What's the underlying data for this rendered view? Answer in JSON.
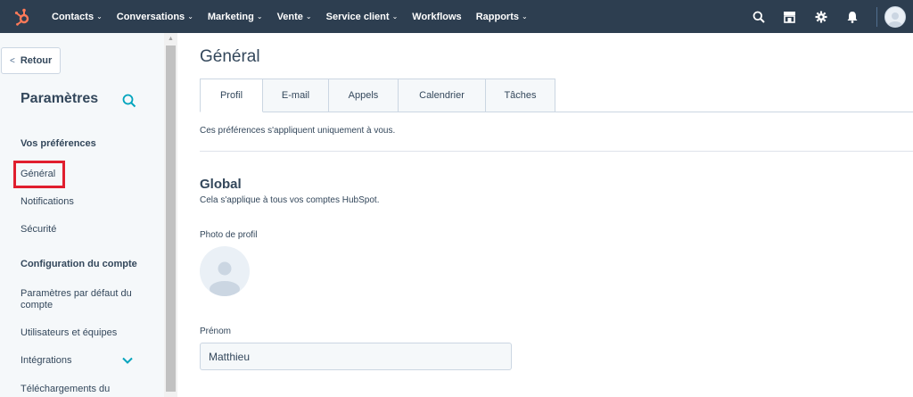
{
  "colors": {
    "nav_bg": "#2d3e50",
    "brand_orange": "#ff7a59",
    "accent_teal": "#00a4bd",
    "highlight_red": "#e01e2e",
    "text": "#33475b"
  },
  "topnav": {
    "logo_icon": "hubspot-sprocket-icon",
    "items": [
      {
        "label": "Contacts",
        "chevron": "⌄"
      },
      {
        "label": "Conversations",
        "chevron": "⌄"
      },
      {
        "label": "Marketing",
        "chevron": "⌄"
      },
      {
        "label": "Vente",
        "chevron": "⌄"
      },
      {
        "label": "Service client",
        "chevron": "⌄"
      },
      {
        "label": "Workflows",
        "chevron": ""
      },
      {
        "label": "Rapports",
        "chevron": "⌄"
      }
    ],
    "right_icons": [
      "search-icon",
      "marketplace-icon",
      "settings-gear-icon",
      "notifications-bell-icon",
      "avatar"
    ]
  },
  "sidebar": {
    "back_label": "Retour",
    "back_glyph": "<",
    "title": "Paramètres",
    "sections": [
      {
        "heading": "Vos préférences",
        "links": [
          "Général",
          "Notifications",
          "Sécurité"
        ]
      },
      {
        "heading": "Configuration du compte",
        "links": [
          "Paramètres par défaut du compte",
          "Utilisateurs et équipes",
          "Intégrations",
          "Téléchargements du"
        ]
      }
    ],
    "active_link": "Général"
  },
  "main": {
    "title": "Général",
    "tabs": [
      "Profil",
      "E-mail",
      "Appels",
      "Calendrier",
      "Tâches"
    ],
    "active_tab": "Profil",
    "tabs_description": "Ces préférences s'appliquent uniquement à vous.",
    "section_title": "Global",
    "section_subtitle": "Cela s'applique à tous vos comptes HubSpot.",
    "photo_label": "Photo de profil",
    "first_name_label": "Prénom",
    "first_name_value": "Matthieu"
  }
}
